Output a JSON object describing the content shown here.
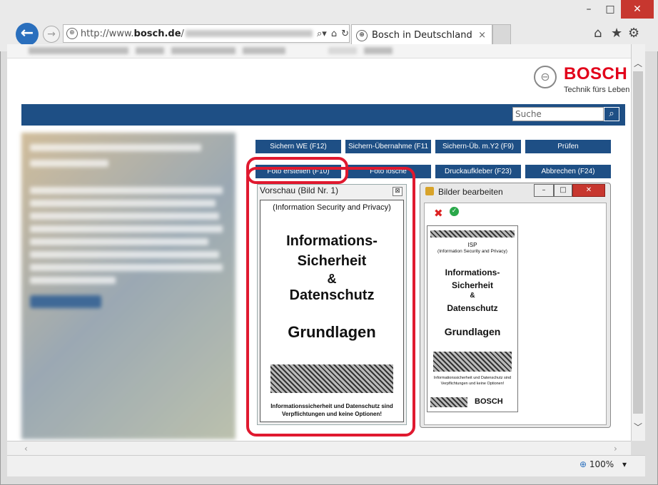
{
  "window": {
    "minimize": "–",
    "maximize": "□",
    "close": "✕"
  },
  "browser": {
    "address_prefix": "http://www.",
    "address_domain": "bosch.de",
    "address_suffix": "/",
    "tab_title": "Bosch in Deutschland",
    "tab_close": "×"
  },
  "brand": {
    "name": "BOSCH",
    "tagline": "Technik fürs Leben"
  },
  "search": {
    "placeholder": "Suche"
  },
  "function_buttons": {
    "row1": [
      "Sichern WE (F12)",
      "Sichern-Übernahme (F11",
      "Sichern-Üb. m.Y2 (F9)",
      "Prüfen"
    ],
    "row2": [
      "Foto erstellen (F10)",
      "Foto lösche",
      "Druckaufkleber (F23)",
      "Abbrechen (F24)"
    ]
  },
  "preview": {
    "title": "Vorschau (Bild Nr. 1)",
    "close": "⊠",
    "doc": {
      "header": "(Information Security and Privacy)",
      "line1": "Informations-",
      "line2": "Sicherheit",
      "line3": "&",
      "line4": "Datenschutz",
      "line5": "Grundlagen",
      "footer1": "Informationssicherheit und Datenschutz sind",
      "footer2": "Verpflichtungen und keine Optionen!"
    }
  },
  "editor": {
    "title": "Bilder bearbeiten",
    "doc": {
      "isp": "ISP",
      "header": "(Information Security and Privacy)",
      "line1": "Informations-",
      "line2": "Sicherheit",
      "line3": "&",
      "line4": "Datenschutz",
      "line5": "Grundlagen",
      "footer1": "Informationssicherheit und Datenschutz sind",
      "footer2": "Verpflichtungen und keine Optionen!",
      "brand": "BOSCH"
    }
  },
  "status": {
    "zoom": "100%"
  }
}
